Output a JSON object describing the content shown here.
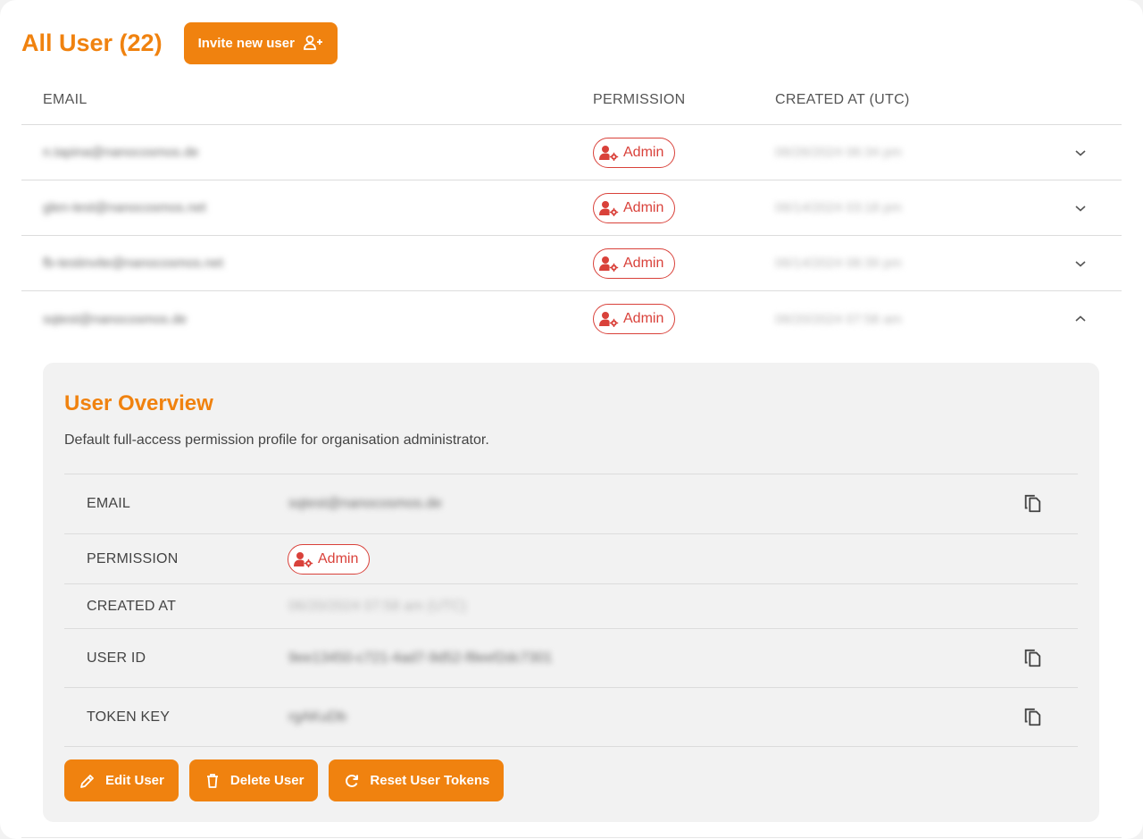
{
  "header": {
    "title": "All User (22)",
    "invite_label": "Invite new user"
  },
  "table": {
    "columns": [
      "EMAIL",
      "PERMISSION",
      "CREATED AT (UTC)"
    ],
    "rows": [
      {
        "email": "n.tapina@nanocosmos.de",
        "permission": "Admin",
        "created": "06/26/2024 06:34 pm",
        "expanded": false
      },
      {
        "email": "glen-test@nanocosmos.net",
        "permission": "Admin",
        "created": "06/14/2024 03:18 pm",
        "expanded": false
      },
      {
        "email": "fb-testinvite@nanocosmos.net",
        "permission": "Admin",
        "created": "06/14/2024 08:39 pm",
        "expanded": false
      },
      {
        "email": "sqtest@nanocosmos.de",
        "permission": "Admin",
        "created": "06/20/2024 07:58 am",
        "expanded": true
      }
    ]
  },
  "overview": {
    "title": "User Overview",
    "description": "Default full-access permission profile for organisation administrator.",
    "fields": {
      "email": {
        "label": "EMAIL",
        "value": "sqtest@nanocosmos.de"
      },
      "permission": {
        "label": "PERMISSION",
        "value": "Admin"
      },
      "created": {
        "label": "CREATED AT",
        "value": "06/20/2024 07:58 am (UTC)"
      },
      "user_id": {
        "label": "USER ID",
        "value": "9ee13450-c721-4ad7-9d52-f8eef2dc7301"
      },
      "token_key": {
        "label": "TOKEN KEY",
        "value": "rgAKuDb"
      }
    },
    "actions": {
      "edit": "Edit User",
      "delete": "Delete User",
      "reset": "Reset User Tokens"
    }
  },
  "colors": {
    "accent": "#f0820f",
    "admin_badge": "#d9413a",
    "panel_bg": "#f2f2f2"
  },
  "icons": {
    "invite": "person-add-icon",
    "admin": "admin-user-gear-icon",
    "expand": "chevron-down-icon",
    "collapse": "chevron-up-icon",
    "copy": "copy-icon",
    "edit": "pencil-icon",
    "delete": "trash-icon",
    "reset": "refresh-icon"
  }
}
